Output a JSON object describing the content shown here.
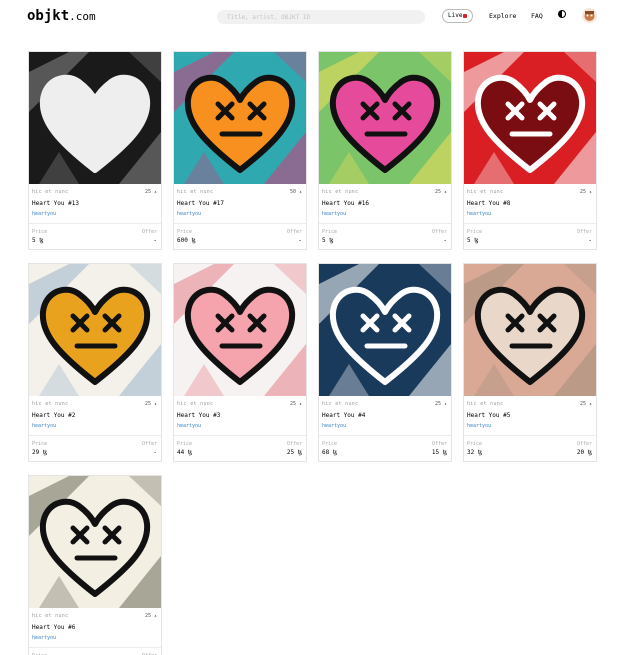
{
  "header": {
    "logo_main": "objkt",
    "logo_tld": ".com",
    "search_placeholder": "Title, artist, OBJKT ID",
    "live_label": "Live",
    "nav_explore": "Explore",
    "nav_faq": "FAQ"
  },
  "cards": [
    {
      "artist": "hic et nunc",
      "editions": "25",
      "title": "Heart You #13",
      "collection": "heartyou",
      "price_label": "Price",
      "offer_label": "Offer",
      "price": "5 ꜩ",
      "offer": "-",
      "bg": "#1a1a1a",
      "heart": "#eeeeee",
      "accent": "#8a8a8a"
    },
    {
      "artist": "hic et nunc",
      "editions": "50",
      "title": "Heart You #17",
      "collection": "heartyou",
      "price_label": "Price",
      "offer_label": "Offer",
      "price": "600 ꜩ",
      "offer": "-",
      "bg": "#2fa8b0",
      "heart": "#f7901e",
      "accent": "#d63a7a"
    },
    {
      "artist": "hic et nunc",
      "editions": "25",
      "title": "Heart You #16",
      "collection": "heartyou",
      "price_label": "Price",
      "offer_label": "Offer",
      "price": "5 ꜩ",
      "offer": "-",
      "bg": "#7cc46a",
      "heart": "#e64a9a",
      "accent": "#f2e05a"
    },
    {
      "artist": "hic et nunc",
      "editions": "25",
      "title": "Heart You #8",
      "collection": "heartyou",
      "price_label": "Price",
      "offer_label": "Offer",
      "price": "5 ꜩ",
      "offer": "-",
      "bg": "#d91f24",
      "heart": "#7a0d12",
      "accent": "#ffffff"
    },
    {
      "artist": "hic et nunc",
      "editions": "25",
      "title": "Heart You #2",
      "collection": "heartyou",
      "price_label": "Price",
      "offer_label": "Offer",
      "price": "29 ꜩ",
      "offer": "-",
      "bg": "#f3f1ea",
      "heart": "#e8a21e",
      "accent": "#9ab4cc"
    },
    {
      "artist": "hic et nunc",
      "editions": "25",
      "title": "Heart You #3",
      "collection": "heartyou",
      "price_label": "Price",
      "offer_label": "Offer",
      "price": "44 ꜩ",
      "offer": "25 ꜩ",
      "bg": "#f7f2f2",
      "heart": "#f5a4ad",
      "accent": "#e47f88"
    },
    {
      "artist": "hic et nunc",
      "editions": "25",
      "title": "Heart You #4",
      "collection": "heartyou",
      "price_label": "Price",
      "offer_label": "Offer",
      "price": "68 ꜩ",
      "offer": "15 ꜩ",
      "bg": "#1a3a5c",
      "heart": "#1a3a5c",
      "accent": "#ffffff"
    },
    {
      "artist": "hic et nunc",
      "editions": "25",
      "title": "Heart You #5",
      "collection": "heartyou",
      "price_label": "Price",
      "offer_label": "Offer",
      "price": "32 ꜩ",
      "offer": "20 ꜩ",
      "bg": "#d9a996",
      "heart": "#e9d8ca",
      "accent": "#a38f7e"
    },
    {
      "artist": "hic et nunc",
      "editions": "25",
      "title": "Heart You #6",
      "collection": "heartyou",
      "price_label": "Price",
      "offer_label": "Offer",
      "price": "",
      "offer": "",
      "bg": "#f3efe3",
      "heart": "#f3efe3",
      "accent": "#6a6a5a"
    }
  ]
}
